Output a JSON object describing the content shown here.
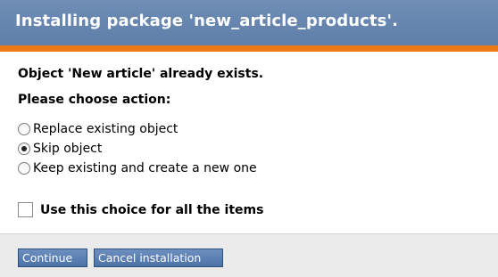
{
  "dialog": {
    "title": "Installing package 'new_article_products'.",
    "message": "Object 'New article' already exists.",
    "prompt": "Please choose action:",
    "options": [
      {
        "label": "Replace existing object",
        "checked": false
      },
      {
        "label": "Skip object",
        "checked": true
      },
      {
        "label": "Keep existing and create a new one",
        "checked": false
      }
    ],
    "apply_all_label": "Use this choice for all the items",
    "apply_all_checked": false,
    "buttons": {
      "continue": "Continue",
      "cancel": "Cancel installation"
    }
  },
  "colors": {
    "titlebar": "#6383ad",
    "accent": "#ec7a16",
    "button": "#5a7fb4",
    "footer": "#ebebeb"
  }
}
